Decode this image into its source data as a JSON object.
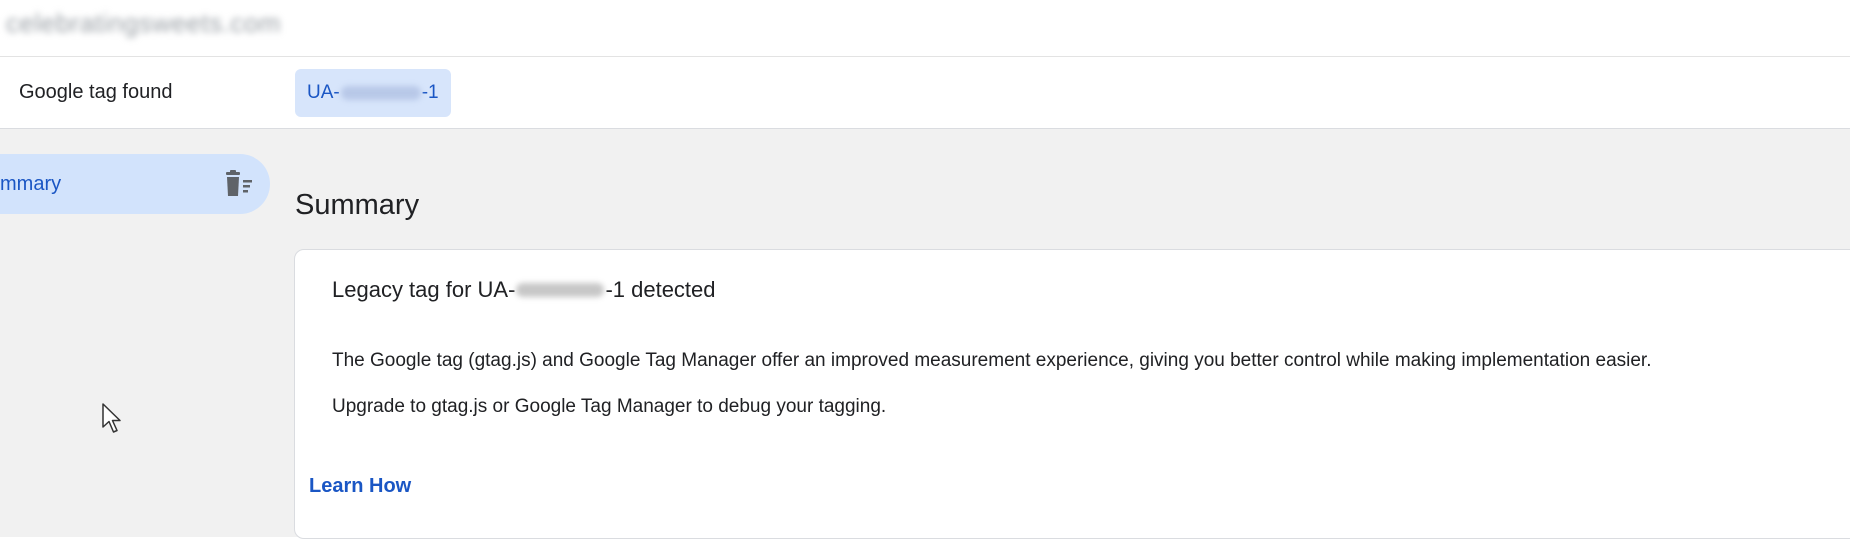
{
  "header": {
    "domain": "celebratingsweets.com"
  },
  "tag_bar": {
    "label": "Google tag found",
    "tag_prefix": "UA-",
    "tag_suffix": "-1"
  },
  "sidebar": {
    "items": [
      {
        "label": "mmary",
        "icon": "delete-sweep-icon",
        "selected": true
      }
    ]
  },
  "main": {
    "heading": "Summary",
    "card": {
      "title_prefix": "Legacy tag for UA-",
      "title_suffix": "-1 detected",
      "body_1": "The Google tag (gtag.js) and Google Tag Manager offer an improved measurement experience, giving you better control while making implementation easier.",
      "body_2": "Upgrade to gtag.js or Google Tag Manager to debug your tagging.",
      "link_label": "Learn How"
    }
  },
  "colors": {
    "accent": "#1a56c4",
    "selected_bg": "#d2e3fc",
    "chip_bg": "#d7e5fb",
    "page_bg": "#f1f1f1"
  }
}
